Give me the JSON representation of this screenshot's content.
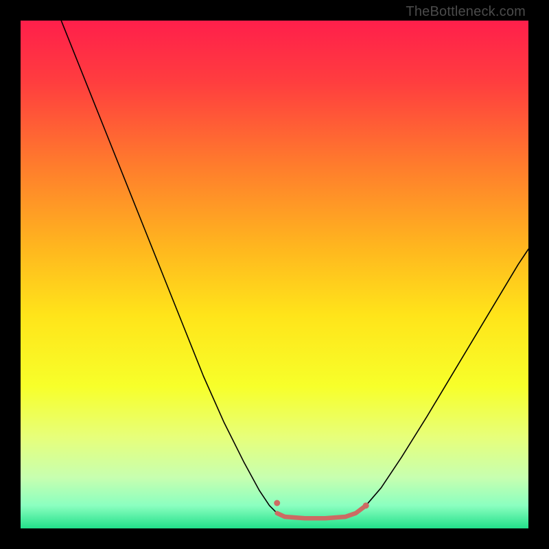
{
  "watermark": "TheBottleneck.com",
  "chart_data": {
    "type": "line",
    "title": "",
    "xlabel": "",
    "ylabel": "",
    "xlim": [
      0,
      100
    ],
    "ylim": [
      0,
      100
    ],
    "grid": false,
    "legend": false,
    "background_gradient_stops": [
      {
        "offset": 0.0,
        "color": "#ff1f4b"
      },
      {
        "offset": 0.12,
        "color": "#ff3d3f"
      },
      {
        "offset": 0.28,
        "color": "#ff7a2d"
      },
      {
        "offset": 0.44,
        "color": "#ffb41f"
      },
      {
        "offset": 0.58,
        "color": "#ffe41a"
      },
      {
        "offset": 0.72,
        "color": "#f7ff2a"
      },
      {
        "offset": 0.82,
        "color": "#e7ff7a"
      },
      {
        "offset": 0.9,
        "color": "#c7ffb0"
      },
      {
        "offset": 0.955,
        "color": "#8bffc0"
      },
      {
        "offset": 1.0,
        "color": "#22e08a"
      }
    ],
    "series": [
      {
        "name": "bottleneck-curve",
        "stroke": "#000000",
        "stroke_width": 1.6,
        "points": [
          {
            "x": 8.0,
            "y": 100.0
          },
          {
            "x": 12.0,
            "y": 90.0
          },
          {
            "x": 16.0,
            "y": 80.0
          },
          {
            "x": 20.0,
            "y": 70.0
          },
          {
            "x": 24.0,
            "y": 60.0
          },
          {
            "x": 28.0,
            "y": 50.0
          },
          {
            "x": 32.0,
            "y": 40.0
          },
          {
            "x": 36.0,
            "y": 30.0
          },
          {
            "x": 40.0,
            "y": 21.0
          },
          {
            "x": 44.0,
            "y": 13.0
          },
          {
            "x": 47.0,
            "y": 7.5
          },
          {
            "x": 49.0,
            "y": 4.5
          },
          {
            "x": 50.5,
            "y": 3.0
          },
          {
            "x": 52.0,
            "y": 2.3
          },
          {
            "x": 56.0,
            "y": 2.0
          },
          {
            "x": 60.0,
            "y": 2.0
          },
          {
            "x": 64.0,
            "y": 2.3
          },
          {
            "x": 66.0,
            "y": 3.0
          },
          {
            "x": 68.0,
            "y": 4.5
          },
          {
            "x": 71.0,
            "y": 8.0
          },
          {
            "x": 75.0,
            "y": 14.0
          },
          {
            "x": 80.0,
            "y": 22.0
          },
          {
            "x": 86.0,
            "y": 32.0
          },
          {
            "x": 92.0,
            "y": 42.0
          },
          {
            "x": 98.0,
            "y": 52.0
          },
          {
            "x": 100.0,
            "y": 55.0
          }
        ]
      },
      {
        "name": "optimal-range-overlay",
        "stroke": "#cc6b63",
        "stroke_width": 6.5,
        "points": [
          {
            "x": 50.5,
            "y": 3.0
          },
          {
            "x": 52.0,
            "y": 2.3
          },
          {
            "x": 56.0,
            "y": 2.0
          },
          {
            "x": 60.0,
            "y": 2.0
          },
          {
            "x": 64.0,
            "y": 2.3
          },
          {
            "x": 66.0,
            "y": 3.0
          },
          {
            "x": 68.0,
            "y": 4.5
          }
        ]
      }
    ],
    "markers": [
      {
        "name": "optimal-start-dot",
        "x": 50.5,
        "y": 5.0,
        "r": 4.5,
        "fill": "#cc6b63"
      },
      {
        "name": "optimal-end-dot",
        "x": 68.0,
        "y": 4.5,
        "r": 4.5,
        "fill": "#cc6b63"
      }
    ]
  }
}
